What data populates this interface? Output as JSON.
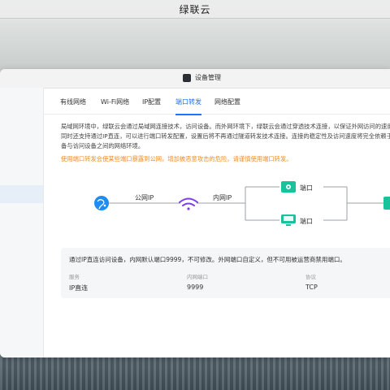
{
  "app": {
    "title": "绿联云"
  },
  "window": {
    "title": "设备管理"
  },
  "tabs": [
    {
      "label": "有线网络"
    },
    {
      "label": "Wi-Fi网络"
    },
    {
      "label": "IP配置"
    },
    {
      "label": "端口转发",
      "active": true
    },
    {
      "label": "网络配置"
    }
  ],
  "main": {
    "description": "局域网环境中，绿联云会通过局域网连接技术，访问设备。而外网环境下，绿联云会通过穿透技术连接，以保证外网访问的速度，同时还支持通过IP直连，可以进行端口转发配置，设置后将不再通过隧道转发技术连接。连接的稳定性及访问速度将完全依赖于设备与访问设备之间的网络环境。",
    "warning": "使用端口转发会使某些端口暴露到公网，增加被恶意攻击的危险，请谨慎使用端口转发。"
  },
  "diagram": {
    "public_ip_label": "公网IP",
    "lan_ip_label": "内网IP",
    "port_label_top": "端口",
    "port_label_bottom": "端口"
  },
  "info": {
    "text": "通过IP直连访问设备，内网默认端口9999，不可修改。外网端口自定义，但不可用被运营商禁用端口。",
    "headers": [
      "服务",
      "内网端口",
      "协议"
    ],
    "row": [
      "IP直连",
      "9999",
      "TCP"
    ]
  },
  "colors": {
    "accent": "#1677ff",
    "warning": "#f28c1f",
    "device": "#18c29c"
  }
}
